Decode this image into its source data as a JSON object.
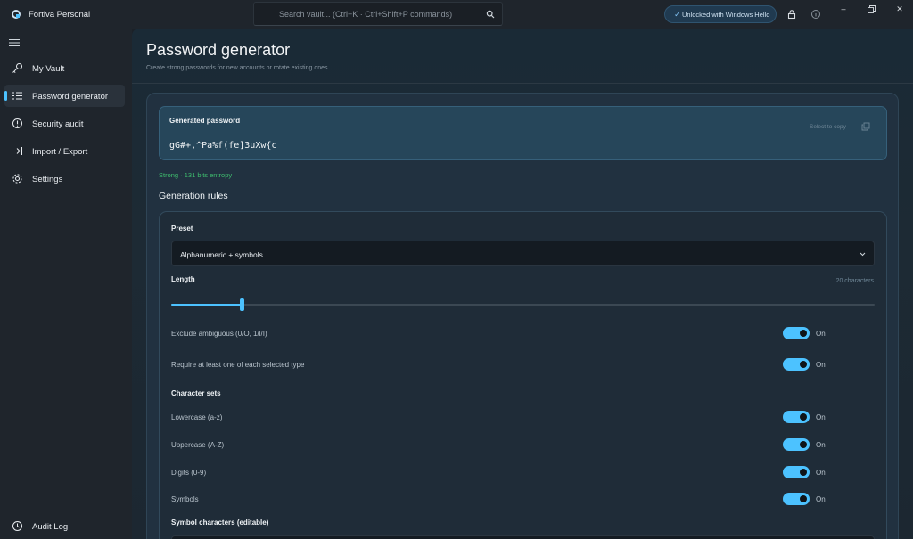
{
  "app": {
    "title": "Fortiva Personal",
    "search_placeholder": "Search vault...  (Ctrl+K · Ctrl+Shift+P commands)",
    "unlock_status": "Unlocked with Windows Hello",
    "accent": "#4cc2ff"
  },
  "sidebar": {
    "items": [
      {
        "label": "My Vault",
        "icon": "key-icon",
        "active": false
      },
      {
        "label": "Password generator",
        "icon": "list-icon",
        "active": true
      },
      {
        "label": "Security audit",
        "icon": "alert-circle-icon",
        "active": false
      },
      {
        "label": "Import / Export",
        "icon": "arrow-right-bar-icon",
        "active": false
      },
      {
        "label": "Settings",
        "icon": "gear-icon",
        "active": false
      }
    ],
    "footer": {
      "label": "Audit Log",
      "icon": "history-icon"
    }
  },
  "page": {
    "title": "Password generator",
    "subtitle": "Create strong passwords for new accounts or rotate existing ones."
  },
  "generated": {
    "label": "Generated password",
    "password": "gG#+,^Pa%f(fe]3uXw{c",
    "copy_hint": "Select to copy",
    "strength": "Strong · 131 bits entropy",
    "strength_color": "#3fbf6f"
  },
  "rules": {
    "title": "Generation rules",
    "preset_label": "Preset",
    "preset_value": "Alphanumeric + symbols",
    "length_label": "Length",
    "length_value": "20 characters",
    "length_fraction": 0.1,
    "toggles": [
      {
        "label": "Exclude ambiguous (0/O, 1/l/I)",
        "state": "On"
      },
      {
        "label": "Require at least one of each selected type",
        "state": "On"
      }
    ],
    "charsets_title": "Character sets",
    "charsets": [
      {
        "label": "Lowercase (a-z)",
        "state": "On"
      },
      {
        "label": "Uppercase (A-Z)",
        "state": "On"
      },
      {
        "label": "Digits (0-9)",
        "state": "On"
      },
      {
        "label": "Symbols",
        "state": "On"
      }
    ],
    "symbols_label": "Symbol characters (editable)"
  }
}
